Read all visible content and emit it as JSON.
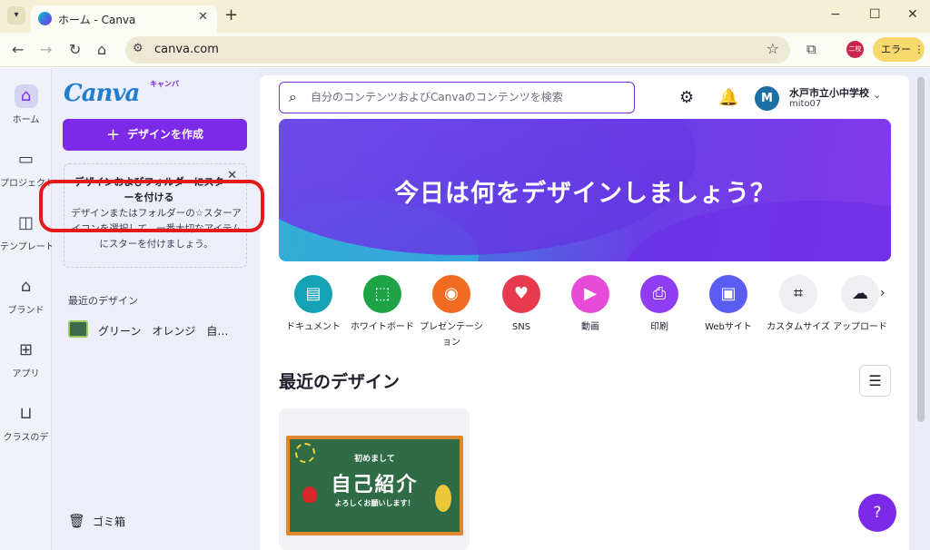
{
  "browser": {
    "tab_title": "ホーム - Canva",
    "tab_close": "✕",
    "new_tab": "+",
    "url": "canva.com",
    "profile_label": "二校",
    "error_label": "エラー",
    "window_min": "−",
    "window_max": "☐",
    "window_close": "✕"
  },
  "rail": {
    "items": [
      {
        "label": "ホーム",
        "icon": "⌂"
      },
      {
        "label": "プロジェクト",
        "icon": "▭"
      },
      {
        "label": "テンプレート",
        "icon": "◫"
      },
      {
        "label": "ブランド",
        "icon": "⌂"
      },
      {
        "label": "アプリ",
        "icon": "⊞"
      },
      {
        "label": "クラスのデ",
        "icon": "⊔"
      }
    ]
  },
  "panel": {
    "logo": "Canva",
    "logo_kana": "キャンバ",
    "create_button": "デザインを作成",
    "tip_title": "デザインおよびフォルダーにスターを付ける",
    "tip_body": "デザインまたはフォルダーの☆スターアイコンを選択して、一番大切なアイテムにスターを付けましょう。",
    "recent_heading": "最近のデザイン",
    "recent_item": "グリーン　オレンジ　自…",
    "trash": "ゴミ箱"
  },
  "header": {
    "search_placeholder": "自分のコンテンツおよびCanvaのコンテンツを検索",
    "account_name": "水戸市立小中学校",
    "account_id": "mito07",
    "avatar_letter": "M"
  },
  "banner": {
    "title": "今日は何をデザインしましょう？"
  },
  "categories": [
    {
      "label": "ドキュメント",
      "color": "#13a3b5"
    },
    {
      "label": "ホワイトボード",
      "color": "#1ea446"
    },
    {
      "label": "プレゼンテーション",
      "color": "#f06b20"
    },
    {
      "label": "SNS",
      "color": "#e83a4e"
    },
    {
      "label": "動画",
      "color": "#e64bd8"
    },
    {
      "label": "印刷",
      "color": "#8e3ef0"
    },
    {
      "label": "Webサイト",
      "color": "#5a5cf2"
    },
    {
      "label": "カスタムサイズ",
      "color": "#eeeef3"
    },
    {
      "label": "アップロード",
      "color": "#eeeef3"
    }
  ],
  "recent": {
    "heading": "最近のデザイン",
    "card": {
      "line1": "初めまして",
      "line2": "自己紹介",
      "line3": "よろしくお願いします！"
    }
  },
  "help_label": "?"
}
